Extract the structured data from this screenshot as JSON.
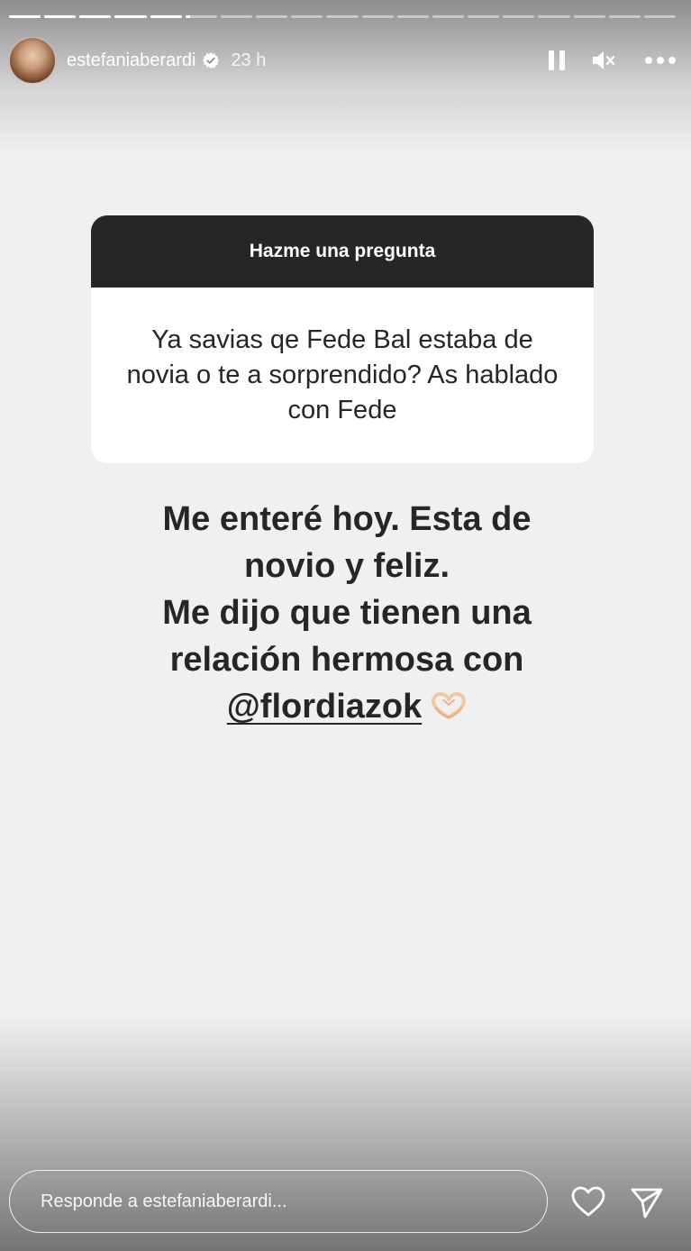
{
  "story": {
    "segments_total": 19,
    "current_segment": 6,
    "current_segment_progress": 0.15,
    "background_color": "#f0f0f0"
  },
  "header": {
    "username": "estefaniaberardi",
    "verified": true,
    "time": "23 h"
  },
  "question_sticker": {
    "title": "Hazme una pregunta",
    "question": "Ya savias qe Fede Bal  estaba de novia  o te a sorprendido?  As hablado con Fede"
  },
  "answer": {
    "lines": [
      "Me enteré hoy. Esta de",
      "novio y feliz.",
      "Me dijo que tienen una",
      "relación hermosa con"
    ],
    "mention": "@flordiazok",
    "emoji": "heart-hands"
  },
  "footer": {
    "reply_placeholder": "Responde a estefaniaberardi..."
  },
  "icons": {
    "pause": "pause-icon",
    "mute": "mute-icon",
    "more": "more-icon",
    "like": "heart-icon",
    "send": "send-icon",
    "verified": "verified-badge-icon"
  }
}
